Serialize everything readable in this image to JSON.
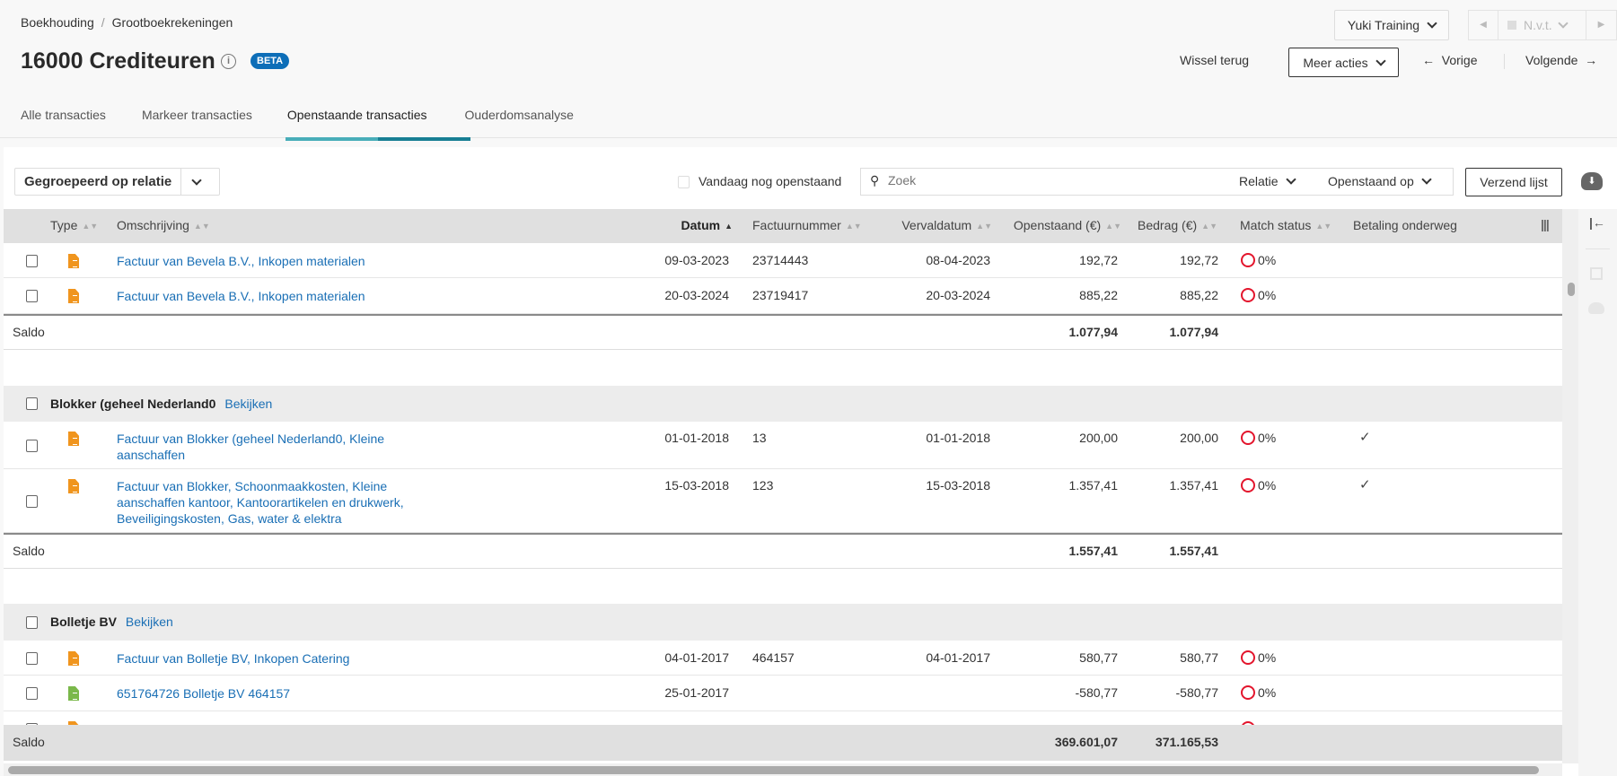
{
  "breadcrumb": {
    "items": [
      "Boekhouding",
      "Grootboekrekeningen"
    ],
    "separator": "/"
  },
  "page": {
    "title": "16000 Crediteuren",
    "info_icon": "i",
    "badge": "BETA"
  },
  "header": {
    "company": "Yuki Training",
    "period": "N.v.t.",
    "switch_back": "Wissel terug",
    "more_actions": "Meer acties",
    "previous": "Vorige",
    "next": "Volgende"
  },
  "tabs": [
    {
      "label": "Alle transacties"
    },
    {
      "label": "Markeer transacties"
    },
    {
      "label": "Openstaande transacties",
      "active": true
    },
    {
      "label": "Ouderdomsanalyse"
    }
  ],
  "toolbar": {
    "grouping": "Gegroepeerd op relatie",
    "today_open": "Vandaag nog openstaand",
    "search_placeholder": "Zoek",
    "filter_relation": "Relatie",
    "filter_open_on": "Openstaand op",
    "send_list": "Verzend lijst"
  },
  "columns": {
    "type": "Type",
    "description": "Omschrijving",
    "date": "Datum",
    "invoice": "Factuurnummer",
    "due": "Vervaldatum",
    "open": "Openstaand (€)",
    "amount": "Bedrag (€)",
    "match": "Match status",
    "payment": "Betaling onderweg"
  },
  "groups": [
    {
      "name": null,
      "rows": [
        {
          "type": "invoice",
          "description": "Factuur van  Bevela B.V., Inkopen materialen",
          "date": "09-03-2023",
          "invoice": "23714443",
          "due": "08-04-2023",
          "open": "192,72",
          "amount": "192,72",
          "match": "0%",
          "payment": false
        },
        {
          "type": "invoice",
          "description": "Factuur van  Bevela B.V., Inkopen materialen",
          "date": "20-03-2024",
          "invoice": "23719417",
          "due": "20-03-2024",
          "open": "885,22",
          "amount": "885,22",
          "match": "0%",
          "payment": false
        }
      ],
      "saldo_label": "Saldo",
      "saldo_open": "1.077,94",
      "saldo_amount": "1.077,94"
    },
    {
      "name": "Blokker (geheel Nederland0",
      "view": "Bekijken",
      "rows": [
        {
          "type": "invoice",
          "description": "Factuur van Blokker (geheel Nederland0, Kleine aanschaffen",
          "date": "01-01-2018",
          "invoice": "13",
          "due": "01-01-2018",
          "open": "200,00",
          "amount": "200,00",
          "match": "0%",
          "payment": true
        },
        {
          "type": "invoice",
          "description": "Factuur van Blokker, Schoonmaakkosten, Kleine aanschaffen kantoor, Kantoorartikelen en drukwerk, Beveiligingskosten, Gas, water & elektra",
          "date": "15-03-2018",
          "invoice": "123",
          "due": "15-03-2018",
          "open": "1.357,41",
          "amount": "1.357,41",
          "match": "0%",
          "payment": true
        }
      ],
      "saldo_label": "Saldo",
      "saldo_open": "1.557,41",
      "saldo_amount": "1.557,41"
    },
    {
      "name": "Bolletje BV",
      "view": "Bekijken",
      "rows": [
        {
          "type": "invoice",
          "description": "Factuur van Bolletje BV, Inkopen Catering",
          "date": "04-01-2017",
          "invoice": "464157",
          "due": "04-01-2017",
          "open": "580,77",
          "amount": "580,77",
          "match": "0%",
          "payment": false
        },
        {
          "type": "payment",
          "description": "651764726 Bolletje BV 464157",
          "date": "25-01-2017",
          "invoice": "",
          "due": "",
          "open": "-580,77",
          "amount": "-580,77",
          "match": "0%",
          "payment": false
        }
      ]
    }
  ],
  "footer": {
    "label": "Saldo",
    "total_open": "369.601,07",
    "total_amount": "371.165,53"
  },
  "colors": {
    "link": "#1a6fb5",
    "badge": "#0d6eb8",
    "match_ring": "#e3152c",
    "invoice_icon": "#f0951e",
    "payment_icon": "#7ab84a"
  }
}
